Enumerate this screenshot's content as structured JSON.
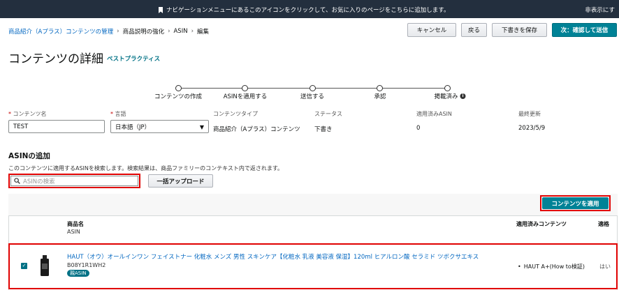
{
  "banner": {
    "message": "ナビゲーションメニューにあるこのアイコンをクリックして、お気に入りのページをこちらに追加します。",
    "hide": "非表示にす"
  },
  "breadcrumb": {
    "items": [
      "商品紹介（Aプラス）コンテンツの管理",
      "商品説明の強化",
      "ASIN",
      "編集"
    ]
  },
  "actions": {
    "cancel": "キャンセル",
    "back": "戻る",
    "save_draft": "下書きを保存",
    "next": "次：確認して送信"
  },
  "page": {
    "title": "コンテンツの詳細",
    "best_practices": "ベストプラクティス"
  },
  "steps": [
    "コンテンツの作成",
    "ASINを適用する",
    "送信する",
    "承認",
    "掲載済み"
  ],
  "fields": {
    "content_name_label": "コンテンツ名",
    "content_name_value": "TEST",
    "language_label": "言語",
    "language_value": "日本語（JP）",
    "content_type_label": "コンテンツタイプ",
    "content_type_value": "商品紹介（Aプラス）コンテンツ",
    "status_label": "ステータス",
    "status_value": "下書き",
    "applied_asin_label": "適用済みASIN",
    "applied_asin_value": "0",
    "last_updated_label": "最終更新",
    "last_updated_value": "2023/5/9"
  },
  "asin_section": {
    "title": "ASINの追加",
    "description": "このコンテンツに適用するASINを検索します。検索結果は、商品ファミリーのコンテキスト内で返されます。",
    "search_placeholder": "ASINの検索",
    "bulk_upload": "一括アップロード",
    "apply_button": "コンテンツを適用"
  },
  "table": {
    "col_product": "商品名",
    "col_asin": "ASIN",
    "col_applied": "適用済みコンテンツ",
    "col_eligible": "適格",
    "rows": [
      {
        "name": "HAUT（オウ）オールインワン フェイストナー 化粧水 メンズ 男性 スキンケア【化粧水 乳液 美容液 保湿】120ml ヒアルロン酸 セラミド ツボクサエキス",
        "asin": "B08Y1R1WH2",
        "badge": "親ASIN",
        "applied": "HAUT A+(How to検証)",
        "eligible": "はい"
      }
    ]
  }
}
